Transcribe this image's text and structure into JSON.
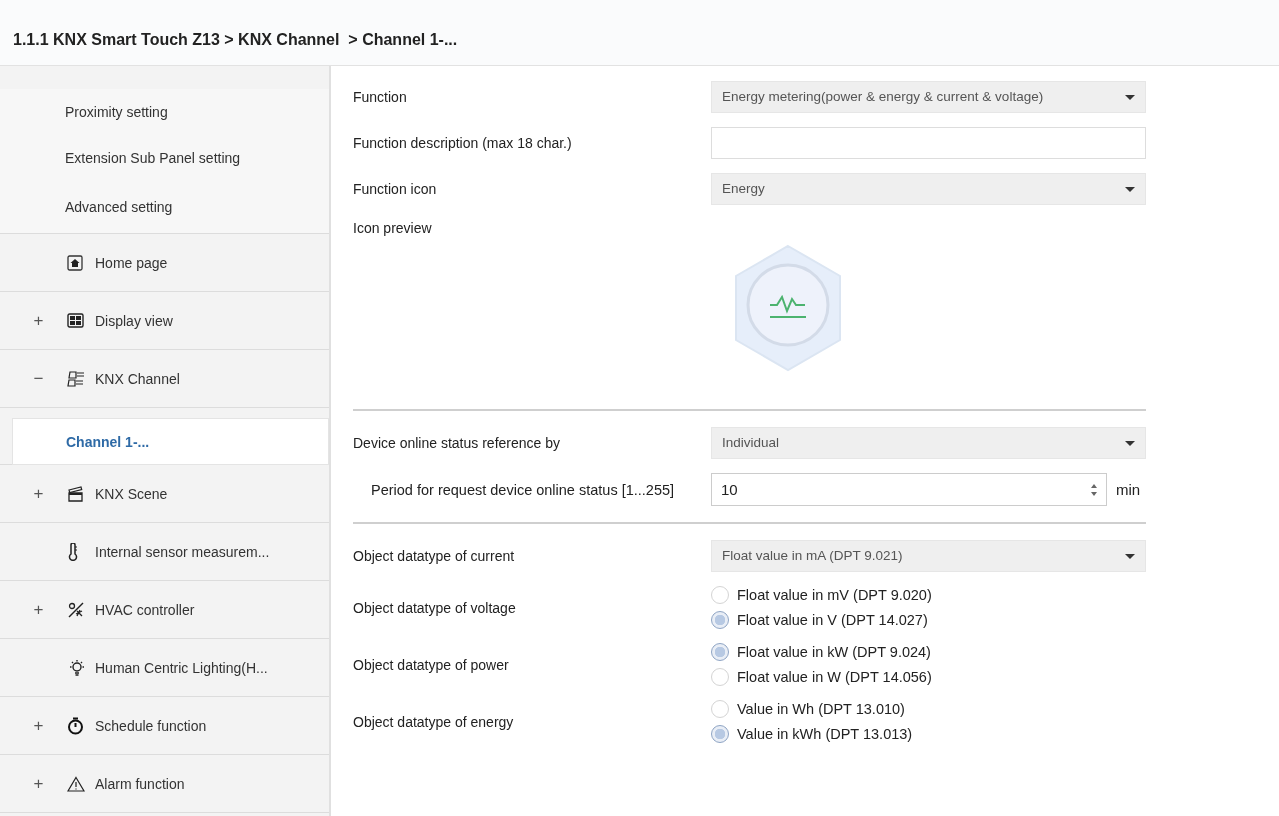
{
  "breadcrumb": "1.1.1 KNX Smart Touch Z13 > KNX Channel  > Channel 1-...",
  "sidebar": {
    "items": [
      {
        "label": "Proximity setting",
        "kind": "sub",
        "selected": false
      },
      {
        "label": "Extension Sub Panel setting",
        "kind": "sub",
        "selected": false
      },
      {
        "label": "Advanced setting",
        "kind": "sub",
        "selected": false
      },
      {
        "label": "Home page",
        "kind": "node",
        "selected": false
      },
      {
        "label": "Display view",
        "kind": "node",
        "toggle": "+",
        "selected": false
      },
      {
        "label": "KNX Channel",
        "kind": "node",
        "toggle": "−",
        "selected": false,
        "children": [
          {
            "label": "Channel 1-...",
            "selected": true
          }
        ]
      },
      {
        "label": "KNX Scene",
        "kind": "node",
        "toggle": "+",
        "selected": false
      },
      {
        "label": "Internal sensor measurem...",
        "kind": "node",
        "selected": false
      },
      {
        "label": "HVAC controller",
        "kind": "node",
        "toggle": "+",
        "selected": false
      },
      {
        "label": "Human Centric Lighting(H...",
        "kind": "node",
        "selected": false
      },
      {
        "label": "Schedule function",
        "kind": "node",
        "toggle": "+",
        "selected": false
      },
      {
        "label": "Alarm function",
        "kind": "node",
        "toggle": "+",
        "selected": false
      }
    ]
  },
  "parameters": {
    "sections": [
      [
        {
          "kind": "select",
          "label": "Function",
          "value": "Energy metering(power & energy & current & voltage)"
        },
        {
          "kind": "text",
          "label": "Function description (max 18 char.)"
        },
        {
          "kind": "select",
          "label": "Function icon",
          "value": "Energy"
        },
        {
          "kind": "preview",
          "label": "Icon preview"
        }
      ],
      [
        {
          "kind": "select",
          "label": "Device online status reference by",
          "value": "Individual"
        },
        {
          "kind": "number",
          "label": "Period for request device online status [1...255]",
          "value": "10",
          "unit": "min"
        }
      ],
      [
        {
          "kind": "select",
          "label": "Object datatype of current",
          "value": "Float value in mA (DPT 9.021)"
        },
        {
          "kind": "radio",
          "label": "Object datatype of voltage",
          "options": [
            {
              "label": "Float value in mV (DPT 9.020)",
              "selected": false
            },
            {
              "label": "Float value in V (DPT 14.027)",
              "selected": true
            }
          ]
        },
        {
          "kind": "radio",
          "label": "Object datatype of power",
          "options": [
            {
              "label": "Float value in kW (DPT 9.024)",
              "selected": true
            },
            {
              "label": "Float value in W (DPT 14.056)",
              "selected": false
            }
          ]
        },
        {
          "kind": "radio",
          "label": "Object datatype of energy",
          "options": [
            {
              "label": "Value in Wh (DPT 13.010)",
              "selected": false
            },
            {
              "label": "Value in kWh (DPT 13.013)",
              "selected": true
            }
          ]
        }
      ]
    ]
  }
}
